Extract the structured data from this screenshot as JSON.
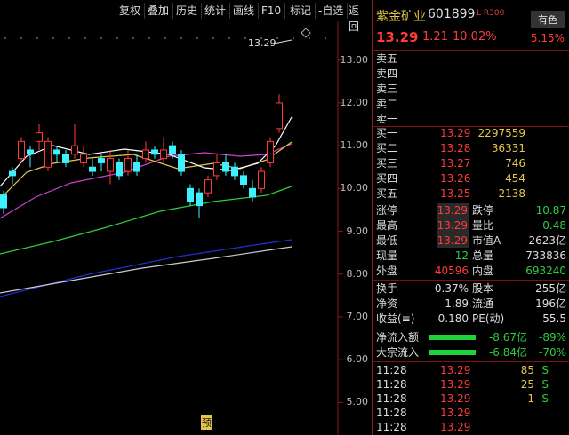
{
  "toolbar": {
    "buttons": [
      "复权",
      "叠加",
      "历史",
      "统计",
      "画线",
      "F10",
      "标记",
      "-自选",
      "返回"
    ]
  },
  "chart": {
    "price_marker": "13.29",
    "y_ticks": [
      "13.00",
      "12.00",
      "11.00",
      "10.00",
      "9.00",
      "8.00",
      "7.00",
      "6.00",
      "5.00"
    ],
    "bottom_marker": "预",
    "candles": [
      {
        "o": 9.85,
        "c": 9.55,
        "h": 9.95,
        "l": 9.4
      },
      {
        "o": 10.4,
        "c": 10.3,
        "h": 10.5,
        "l": 10.1
      },
      {
        "o": 10.7,
        "c": 11.1,
        "h": 11.2,
        "l": 10.6
      },
      {
        "o": 10.9,
        "c": 10.8,
        "h": 11.0,
        "l": 10.5
      },
      {
        "o": 11.1,
        "c": 11.3,
        "h": 11.5,
        "l": 10.9
      },
      {
        "o": 10.5,
        "c": 11.1,
        "h": 11.2,
        "l": 10.4
      },
      {
        "o": 10.9,
        "c": 10.8,
        "h": 11.0,
        "l": 10.6
      },
      {
        "o": 10.8,
        "c": 10.6,
        "h": 10.9,
        "l": 10.5
      },
      {
        "o": 10.8,
        "c": 11.0,
        "h": 11.5,
        "l": 10.7
      },
      {
        "o": 10.6,
        "c": 10.8,
        "h": 11.0,
        "l": 10.5
      },
      {
        "o": 10.5,
        "c": 10.4,
        "h": 10.7,
        "l": 10.3
      },
      {
        "o": 10.7,
        "c": 10.6,
        "h": 10.8,
        "l": 10.4
      },
      {
        "o": 10.4,
        "c": 10.7,
        "h": 10.9,
        "l": 10.1
      },
      {
        "o": 10.6,
        "c": 10.3,
        "h": 10.7,
        "l": 10.2
      },
      {
        "o": 10.4,
        "c": 10.7,
        "h": 10.9,
        "l": 10.3
      },
      {
        "o": 10.6,
        "c": 10.4,
        "h": 10.8,
        "l": 10.3
      },
      {
        "o": 10.7,
        "c": 10.9,
        "h": 11.1,
        "l": 10.6
      },
      {
        "o": 10.9,
        "c": 10.8,
        "h": 11.0,
        "l": 10.7
      },
      {
        "o": 10.7,
        "c": 10.9,
        "h": 11.2,
        "l": 10.6
      },
      {
        "o": 11.0,
        "c": 10.8,
        "h": 11.1,
        "l": 10.7
      },
      {
        "o": 10.8,
        "c": 10.4,
        "h": 10.9,
        "l": 10.3
      },
      {
        "o": 10.0,
        "c": 9.7,
        "h": 10.1,
        "l": 9.6
      },
      {
        "o": 9.9,
        "c": 9.6,
        "h": 10.0,
        "l": 9.3
      },
      {
        "o": 9.9,
        "c": 10.2,
        "h": 10.3,
        "l": 9.8
      },
      {
        "o": 10.3,
        "c": 10.6,
        "h": 10.8,
        "l": 10.2
      },
      {
        "o": 10.6,
        "c": 10.4,
        "h": 10.8,
        "l": 10.3
      },
      {
        "o": 10.5,
        "c": 10.3,
        "h": 10.6,
        "l": 10.2
      },
      {
        "o": 10.3,
        "c": 10.1,
        "h": 10.4,
        "l": 10.0
      },
      {
        "o": 10.0,
        "c": 9.8,
        "h": 10.2,
        "l": 9.7
      },
      {
        "o": 10.0,
        "c": 10.4,
        "h": 10.5,
        "l": 9.9
      },
      {
        "o": 10.6,
        "c": 11.1,
        "h": 11.2,
        "l": 10.5
      },
      {
        "o": 11.4,
        "c": 12.0,
        "h": 12.2,
        "l": 11.3
      }
    ]
  },
  "stock": {
    "name": "紫金矿业",
    "code": "601899",
    "flags": "L R300",
    "tag": "有色",
    "price": "13.29",
    "change": "1.21",
    "change_pct": "10.02%",
    "pct2": "5.15%"
  },
  "orderbook": {
    "asks": [
      {
        "label": "卖五",
        "price": "",
        "vol": ""
      },
      {
        "label": "卖四",
        "price": "",
        "vol": ""
      },
      {
        "label": "卖三",
        "price": "",
        "vol": ""
      },
      {
        "label": "卖二",
        "price": "",
        "vol": ""
      },
      {
        "label": "卖一",
        "price": "",
        "vol": ""
      }
    ],
    "bids": [
      {
        "label": "买一",
        "price": "13.29",
        "vol": "2297559"
      },
      {
        "label": "买二",
        "price": "13.28",
        "vol": "36331"
      },
      {
        "label": "买三",
        "price": "13.27",
        "vol": "746"
      },
      {
        "label": "买四",
        "price": "13.26",
        "vol": "454"
      },
      {
        "label": "买五",
        "price": "13.25",
        "vol": "2138"
      }
    ]
  },
  "stats1": [
    {
      "l1": "涨停",
      "v1": "13.29",
      "l2": "跌停",
      "v2": "10.87"
    },
    {
      "l1": "最高",
      "v1": "13.29",
      "l2": "量比",
      "v2": "0.48"
    },
    {
      "l1": "最低",
      "v1": "13.29",
      "l2": "市值A",
      "v2": "2623亿"
    },
    {
      "l1": "现量",
      "v1": "12",
      "l2": "总量",
      "v2": "733836"
    },
    {
      "l1": "外盘",
      "v1": "40596",
      "l2": "内盘",
      "v2": "693240"
    }
  ],
  "stats2": [
    {
      "l1": "换手",
      "v1": "0.37%",
      "l2": "股本",
      "v2": "255亿"
    },
    {
      "l1": "净资",
      "v1": "1.89",
      "l2": "流通",
      "v2": "196亿"
    },
    {
      "l1": "收益(≡)",
      "v1": "0.180",
      "l2": "PE(动)",
      "v2": "55.5"
    }
  ],
  "flows": [
    {
      "label": "净流入额",
      "value": "-8.67亿",
      "pct": "-89%"
    },
    {
      "label": "大宗流入",
      "value": "-6.84亿",
      "pct": "-70%"
    }
  ],
  "ticks": [
    {
      "time": "11:28",
      "price": "13.29",
      "vol": "85",
      "side": "S"
    },
    {
      "time": "11:28",
      "price": "13.29",
      "vol": "25",
      "side": "S"
    },
    {
      "time": "11:28",
      "price": "13.29",
      "vol": "1",
      "side": "S"
    },
    {
      "time": "11:28",
      "price": "13.29",
      "vol": "",
      "side": ""
    },
    {
      "time": "11:28",
      "price": "13.29",
      "vol": "",
      "side": ""
    }
  ],
  "colors": {
    "up": "#ff3b3b",
    "down": "#3ff0ff",
    "accent": "#e6c64a"
  }
}
